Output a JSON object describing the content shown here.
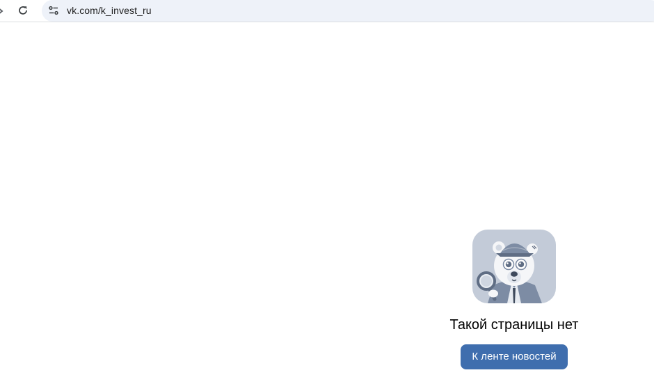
{
  "browser": {
    "url": "vk.com/k_invest_ru",
    "icons": [
      "forward-icon",
      "reload-icon",
      "site-info-icon"
    ]
  },
  "not_found": {
    "illustration": "detective-bear-with-magnifier",
    "title": "Такой страницы нет",
    "button_label": "К ленте новостей"
  },
  "colors": {
    "accent": "#3f6eae",
    "omnibox_bg": "#eef2f9",
    "illustration_bg": "#c3cbd8"
  }
}
